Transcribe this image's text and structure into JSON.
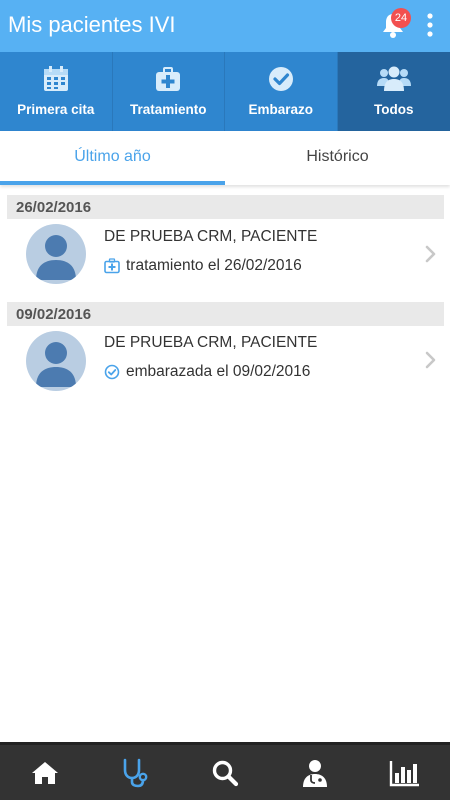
{
  "app": {
    "title": "Mis pacientes IVI",
    "notifications_count": "24",
    "colors": {
      "appbar": "#57b1f3",
      "tabs": "#2f86cf",
      "tab_active": "#24649e",
      "accent": "#4aa3ea",
      "bottom_nav": "#333333"
    }
  },
  "categories": [
    {
      "label": "Primera cita",
      "icon": "calendar-icon"
    },
    {
      "label": "Tratamiento",
      "icon": "medical-kit-icon"
    },
    {
      "label": "Embarazo",
      "icon": "check-circle-icon"
    },
    {
      "label": "Todos",
      "icon": "users-icon",
      "active": true
    }
  ],
  "period_tabs": [
    {
      "label": "Último año",
      "active": true
    },
    {
      "label": "Histórico"
    }
  ],
  "entries": [
    {
      "date": "26/02/2016",
      "patient": "DE PRUEBA CRM, PACIENTE",
      "status": "tratamiento el 26/02/2016",
      "status_icon": "medical-kit-icon"
    },
    {
      "date": "09/02/2016",
      "patient": "DE PRUEBA CRM, PACIENTE",
      "status": "embarazada el 09/02/2016",
      "status_icon": "check-circle-icon"
    }
  ],
  "bottom_nav": [
    {
      "icon": "home-icon"
    },
    {
      "icon": "stethoscope-icon",
      "active": true
    },
    {
      "icon": "search-icon"
    },
    {
      "icon": "doctor-icon"
    },
    {
      "icon": "bar-chart-icon"
    }
  ]
}
